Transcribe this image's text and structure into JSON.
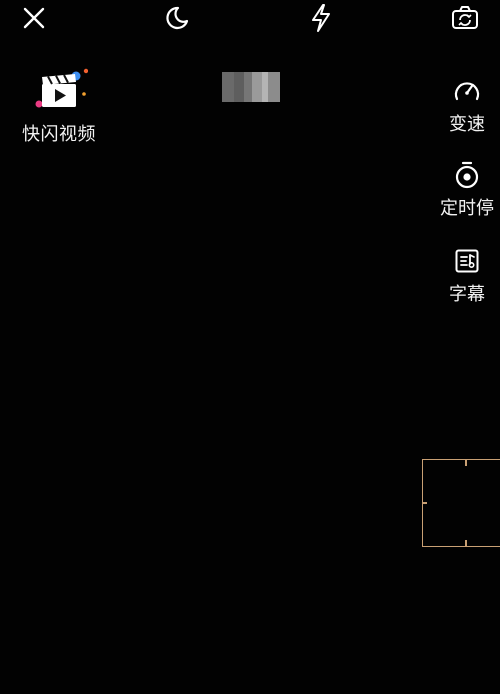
{
  "top_bar": {
    "close_icon": "close-icon",
    "night_icon": "moon-icon",
    "flash_icon": "flash-icon",
    "flip_icon": "camera-flip-icon"
  },
  "app": {
    "label": "快闪视频",
    "icon": "clapperboard-icon"
  },
  "side_tools": [
    {
      "label": "变速",
      "icon": "speedometer-icon"
    },
    {
      "label": "定时停",
      "icon": "timer-icon"
    },
    {
      "label": "字幕",
      "icon": "subtitle-icon"
    }
  ],
  "colors": {
    "background": "#020202",
    "text": "#f2f2f2",
    "frame": "#c9a074"
  }
}
